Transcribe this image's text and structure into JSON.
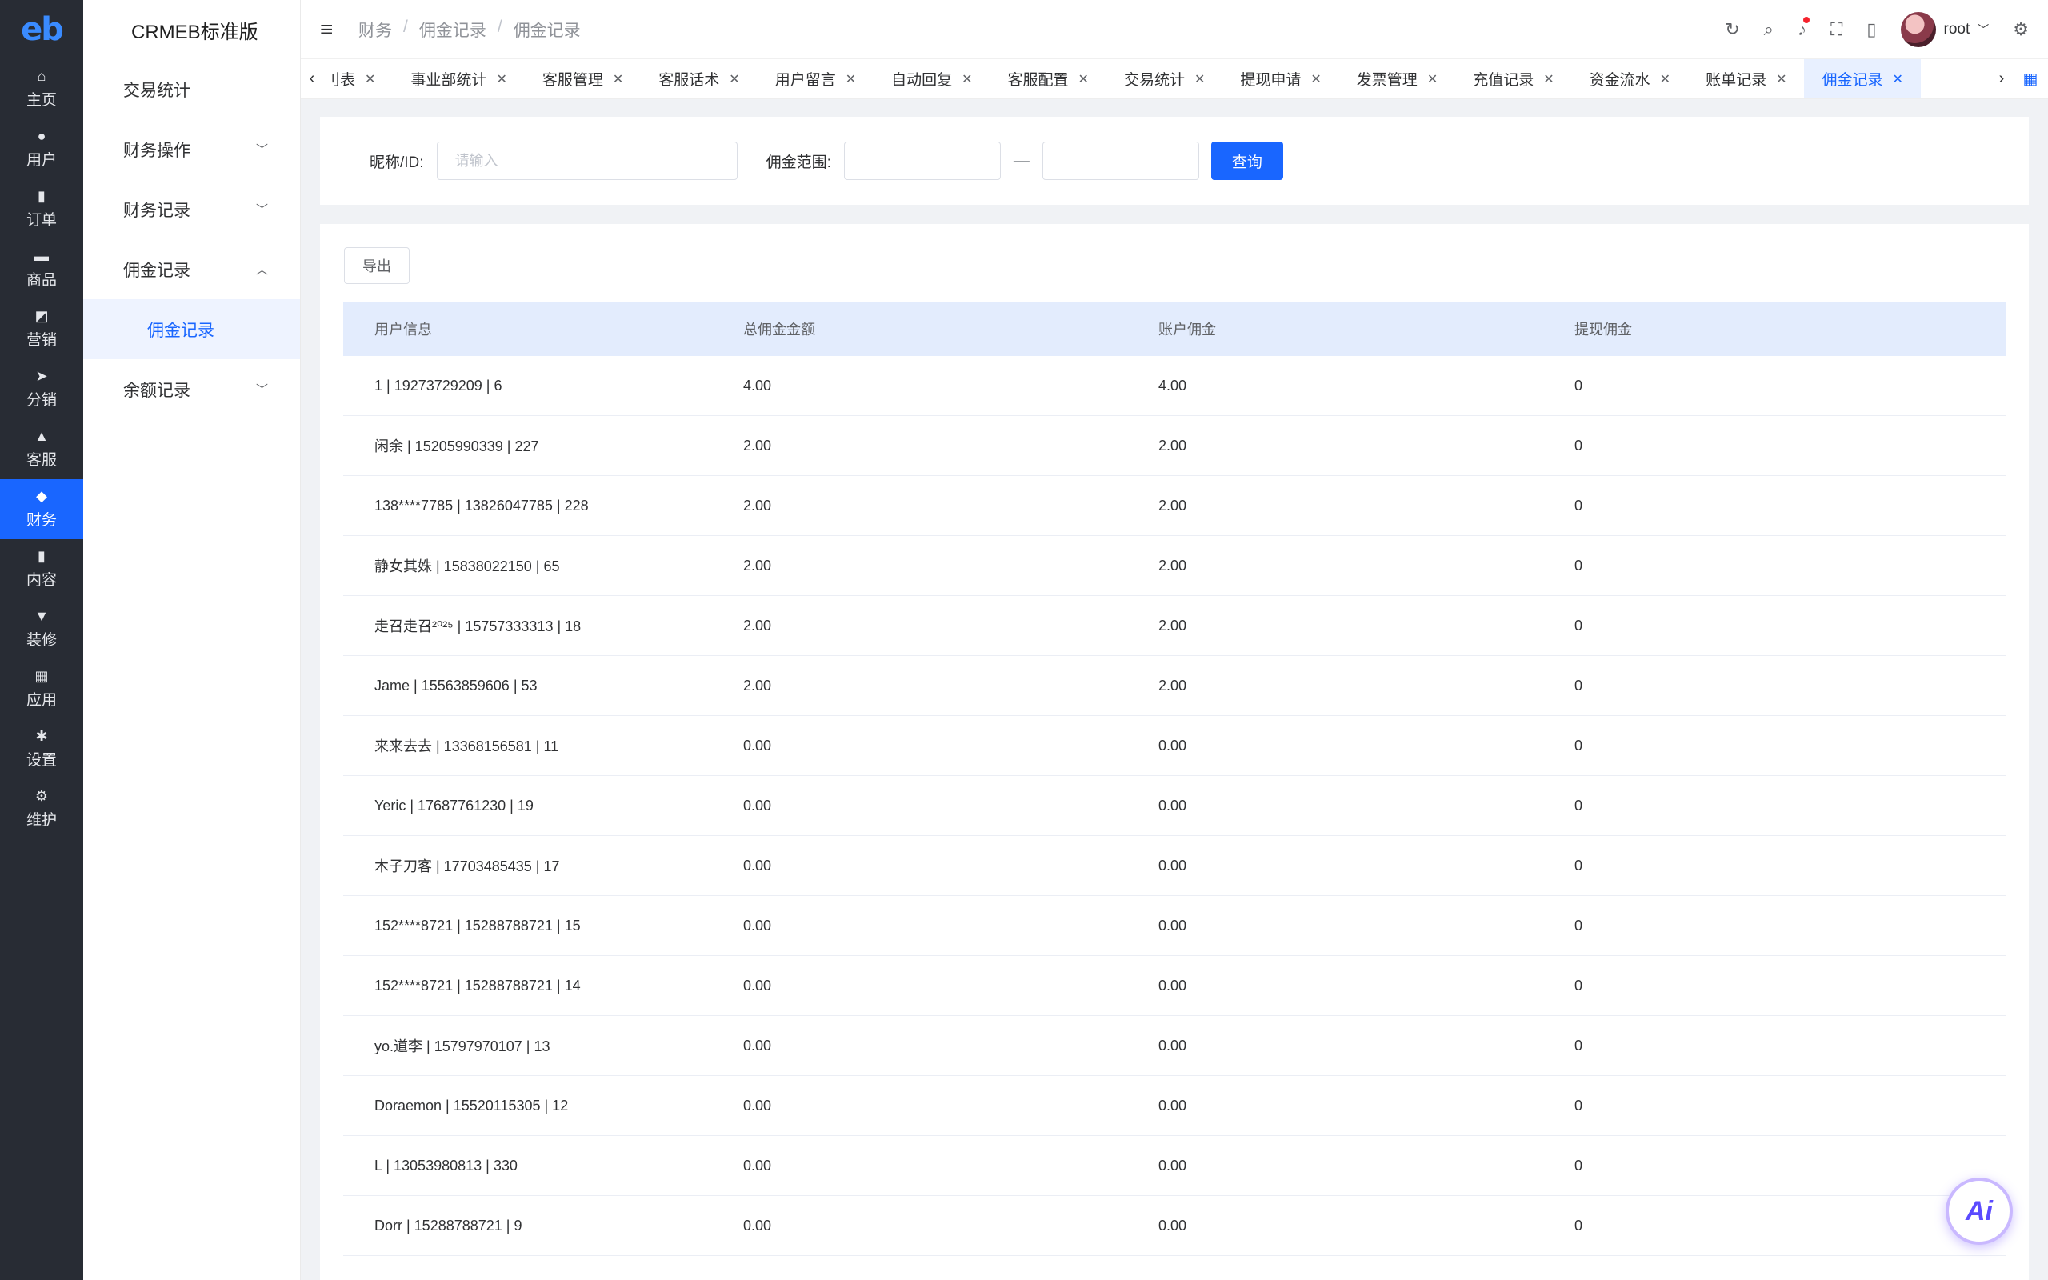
{
  "rail": {
    "logo": "eb",
    "items": [
      {
        "label": "主页",
        "icon": "home-icon",
        "glyph": "⌂",
        "active": false
      },
      {
        "label": "用户",
        "icon": "user-icon",
        "glyph": "●",
        "active": false
      },
      {
        "label": "订单",
        "icon": "order-icon",
        "glyph": "▮",
        "active": false
      },
      {
        "label": "商品",
        "icon": "product-icon",
        "glyph": "▬",
        "active": false
      },
      {
        "label": "营销",
        "icon": "marketing-icon",
        "glyph": "◩",
        "active": false
      },
      {
        "label": "分销",
        "icon": "distribution-icon",
        "glyph": "➤",
        "active": false
      },
      {
        "label": "客服",
        "icon": "service-icon",
        "glyph": "▲",
        "active": false
      },
      {
        "label": "财务",
        "icon": "finance-icon",
        "glyph": "◆",
        "active": true
      },
      {
        "label": "内容",
        "icon": "content-icon",
        "glyph": "▮",
        "active": false
      },
      {
        "label": "装修",
        "icon": "decorate-icon",
        "glyph": "▼",
        "active": false
      },
      {
        "label": "应用",
        "icon": "apps-icon",
        "glyph": "▦",
        "active": false
      },
      {
        "label": "设置",
        "icon": "settings-icon",
        "glyph": "✱",
        "active": false
      },
      {
        "label": "维护",
        "icon": "maintain-icon",
        "glyph": "⚙",
        "active": false
      }
    ]
  },
  "submenu": {
    "brand": "CRMEB标准版",
    "items": [
      {
        "label": "交易统计",
        "chevron": ""
      },
      {
        "label": "财务操作",
        "chevron": "﹀"
      },
      {
        "label": "财务记录",
        "chevron": "﹀"
      },
      {
        "label": "佣金记录",
        "chevron": "︿"
      }
    ],
    "active_child": "佣金记录",
    "after": {
      "label": "余额记录",
      "chevron": "﹀"
    }
  },
  "header": {
    "crumbs": [
      "财务",
      "佣金记录",
      "佣金记录"
    ],
    "user": "root"
  },
  "tabs": {
    "items": [
      {
        "label": "刂表",
        "active": false
      },
      {
        "label": "事业部统计",
        "active": false
      },
      {
        "label": "客服管理",
        "active": false
      },
      {
        "label": "客服话术",
        "active": false
      },
      {
        "label": "用户留言",
        "active": false
      },
      {
        "label": "自动回复",
        "active": false
      },
      {
        "label": "客服配置",
        "active": false
      },
      {
        "label": "交易统计",
        "active": false
      },
      {
        "label": "提现申请",
        "active": false
      },
      {
        "label": "发票管理",
        "active": false
      },
      {
        "label": "充值记录",
        "active": false
      },
      {
        "label": "资金流水",
        "active": false
      },
      {
        "label": "账单记录",
        "active": false
      },
      {
        "label": "佣金记录",
        "active": true
      }
    ]
  },
  "filter": {
    "nickname_label": "昵称/ID:",
    "nickname_placeholder": "请输入",
    "range_label": "佣金范围:",
    "range_min": "",
    "range_max": "",
    "dash": "—",
    "search_button": "查询"
  },
  "table": {
    "export_button": "导出",
    "columns": [
      "用户信息",
      "总佣金金额",
      "账户佣金",
      "提现佣金"
    ],
    "rows": [
      [
        "1 | 19273729209 | 6",
        "4.00",
        "4.00",
        "0"
      ],
      [
        "闲余 | 15205990339 | 227",
        "2.00",
        "2.00",
        "0"
      ],
      [
        "138****7785 | 13826047785 | 228",
        "2.00",
        "2.00",
        "0"
      ],
      [
        "静女其姝 | 15838022150 | 65",
        "2.00",
        "2.00",
        "0"
      ],
      [
        "走召走召²⁰²⁵ | 15757333313 | 18",
        "2.00",
        "2.00",
        "0"
      ],
      [
        "Jame | 15563859606 | 53",
        "2.00",
        "2.00",
        "0"
      ],
      [
        "来来去去 | 13368156581 | 11",
        "0.00",
        "0.00",
        "0"
      ],
      [
        "Yeric | 17687761230 | 19",
        "0.00",
        "0.00",
        "0"
      ],
      [
        "木子刀客 | 17703485435 | 17",
        "0.00",
        "0.00",
        "0"
      ],
      [
        "152****8721 | 15288788721 | 15",
        "0.00",
        "0.00",
        "0"
      ],
      [
        "152****8721 | 15288788721 | 14",
        "0.00",
        "0.00",
        "0"
      ],
      [
        "yo.道李 | 15797970107 | 13",
        "0.00",
        "0.00",
        "0"
      ],
      [
        "Doraemon | 15520115305 | 12",
        "0.00",
        "0.00",
        "0"
      ],
      [
        "L | 13053980813 | 330",
        "0.00",
        "0.00",
        "0"
      ],
      [
        "Dorr | 15288788721 | 9",
        "0.00",
        "0.00",
        "0"
      ]
    ]
  },
  "ai_button": "Ai"
}
